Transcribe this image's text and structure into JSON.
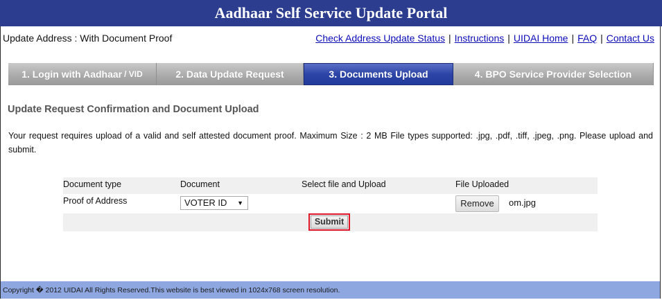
{
  "header": {
    "title": "Aadhaar Self Service Update Portal"
  },
  "subheader": {
    "section_label": "Update Address : With Document Proof",
    "links": [
      "Check Address Update Status",
      "Instructions",
      "UIDAI Home",
      "FAQ",
      "Contact Us"
    ]
  },
  "tabs": [
    {
      "label": "1. Login with Aadhaar",
      "suffix": "/ VID"
    },
    {
      "label": "2. Data Update Request"
    },
    {
      "label": "3. Documents Upload"
    },
    {
      "label": "4. BPO Service Provider Selection"
    }
  ],
  "main": {
    "title": "Update Request Confirmation and Document Upload",
    "instructions": "Your request requires upload of a valid and self attested document proof. Maximum Size : 2 MB File types supported: .jpg, .pdf, .tiff, .jpeg, .png. Please upload and submit."
  },
  "table": {
    "headers": [
      "Document type",
      "Document",
      "Select file and Upload",
      "File Uploaded"
    ],
    "row": {
      "document_type": "Proof of Address",
      "document_selected": "VOTER ID",
      "remove_label": "Remove",
      "file_name": "om.jpg"
    },
    "submit_label": "Submit"
  },
  "footer": {
    "text": "Copyright � 2012 UIDAI All Rights Reserved.This website is best viewed in 1024x768 screen resolution."
  },
  "colors": {
    "title_bar": "#2c3d8f",
    "active_tab": "#2d45a8",
    "footer": "#8ea7e0",
    "highlight": "#e0162b"
  }
}
